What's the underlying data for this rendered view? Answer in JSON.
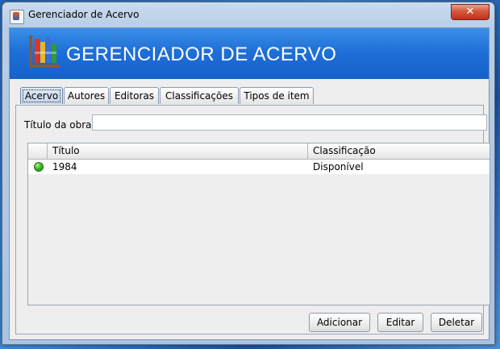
{
  "window": {
    "title": "Gerenciador de Acervo",
    "close_label": "✕"
  },
  "banner": {
    "title": "GERENCIADOR DE ACERVO"
  },
  "tabs": [
    {
      "label": "Acervo"
    },
    {
      "label": "Autores"
    },
    {
      "label": "Editoras"
    },
    {
      "label": "Classificações"
    },
    {
      "label": "Tipos de item"
    }
  ],
  "search": {
    "label": "Título da obra",
    "value": ""
  },
  "table": {
    "columns": [
      "",
      "Título",
      "Classificação"
    ],
    "rows": [
      {
        "titulo": "1984",
        "classificacao": "Disponível",
        "status_color": "#3fbb2a"
      }
    ]
  },
  "actions": {
    "add": "Adicionar",
    "edit": "Editar",
    "delete": "Deletar"
  }
}
